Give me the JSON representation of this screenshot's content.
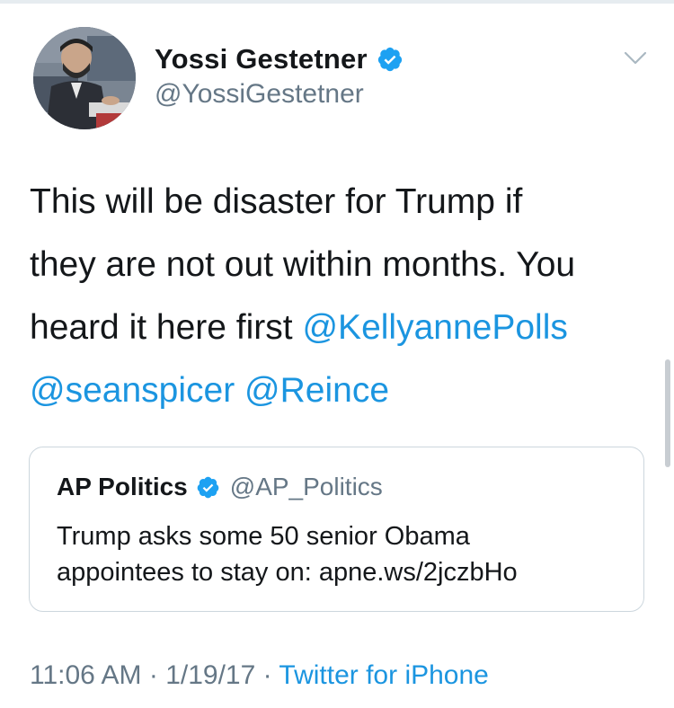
{
  "tweet": {
    "author": {
      "display_name": "Yossi Gestetner",
      "handle": "@YossiGestetner",
      "verified": true
    },
    "text": {
      "line1": "This will be disaster for Trump if",
      "line2": "they are not out within months. You",
      "line3_prefix": "heard it here first ",
      "mention1": "@KellyannePolls",
      "mention2": "@seanspicer",
      "mention3": "@Reince"
    },
    "quoted": {
      "display_name": "AP Politics",
      "handle": "@AP_Politics",
      "verified": true,
      "text_line1": "Trump asks some 50 senior Obama",
      "text_line2": "appointees to stay on: apne.ws/2jczbHo"
    },
    "time": "11:06 AM",
    "separator": " · ",
    "date": "1/19/17",
    "source": "Twitter for iPhone"
  },
  "icons": {
    "verified": "verified-badge-icon",
    "menu": "chevron-down-icon"
  },
  "colors": {
    "link": "#1b95e0",
    "secondary_text": "#657786",
    "primary_text": "#14171a",
    "border": "#ccd6dd"
  }
}
